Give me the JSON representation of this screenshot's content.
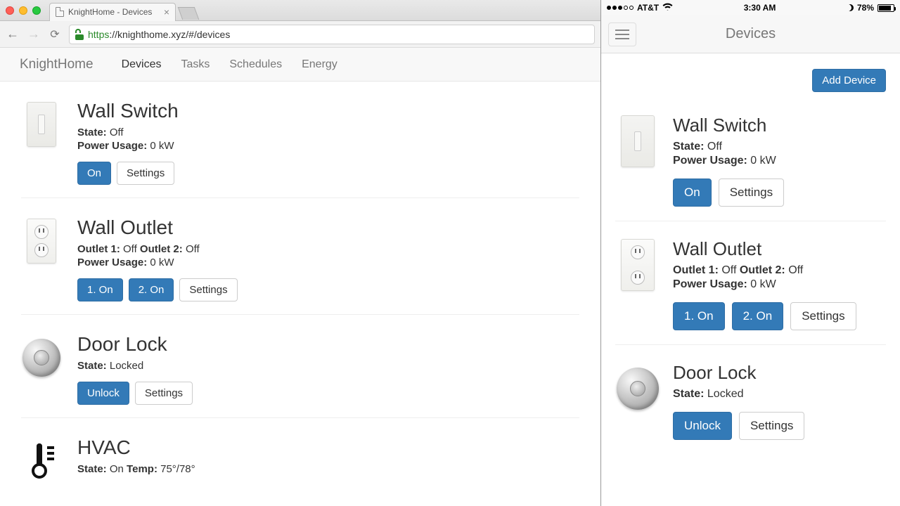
{
  "browser": {
    "tab_title": "KnightHome - Devices",
    "url_scheme": "https",
    "url_rest": "://knighthome.xyz/#/devices"
  },
  "app": {
    "brand": "KnightHome",
    "nav": {
      "devices": "Devices",
      "tasks": "Tasks",
      "schedules": "Schedules",
      "energy": "Energy"
    }
  },
  "labels": {
    "state": "State:",
    "power_usage": "Power Usage:",
    "outlet1": "Outlet 1:",
    "outlet2": "Outlet 2:",
    "temp": "Temp:",
    "settings": "Settings",
    "on": "On",
    "one_on": "1. On",
    "two_on": "2. On",
    "unlock": "Unlock",
    "add_device": "Add Device"
  },
  "devices": {
    "wall_switch": {
      "title": "Wall Switch",
      "state": "Off",
      "power": "0 kW"
    },
    "wall_outlet": {
      "title": "Wall Outlet",
      "o1": "Off",
      "o2": "Off",
      "power": "0 kW"
    },
    "door_lock": {
      "title": "Door Lock",
      "state": "Locked"
    },
    "hvac": {
      "title": "HVAC",
      "state": "On",
      "temp": "75°/78°"
    }
  },
  "mobile": {
    "carrier": "AT&T",
    "time": "3:30 AM",
    "battery_pct": "78%",
    "battery_fill_pct": 78,
    "header": "Devices"
  }
}
